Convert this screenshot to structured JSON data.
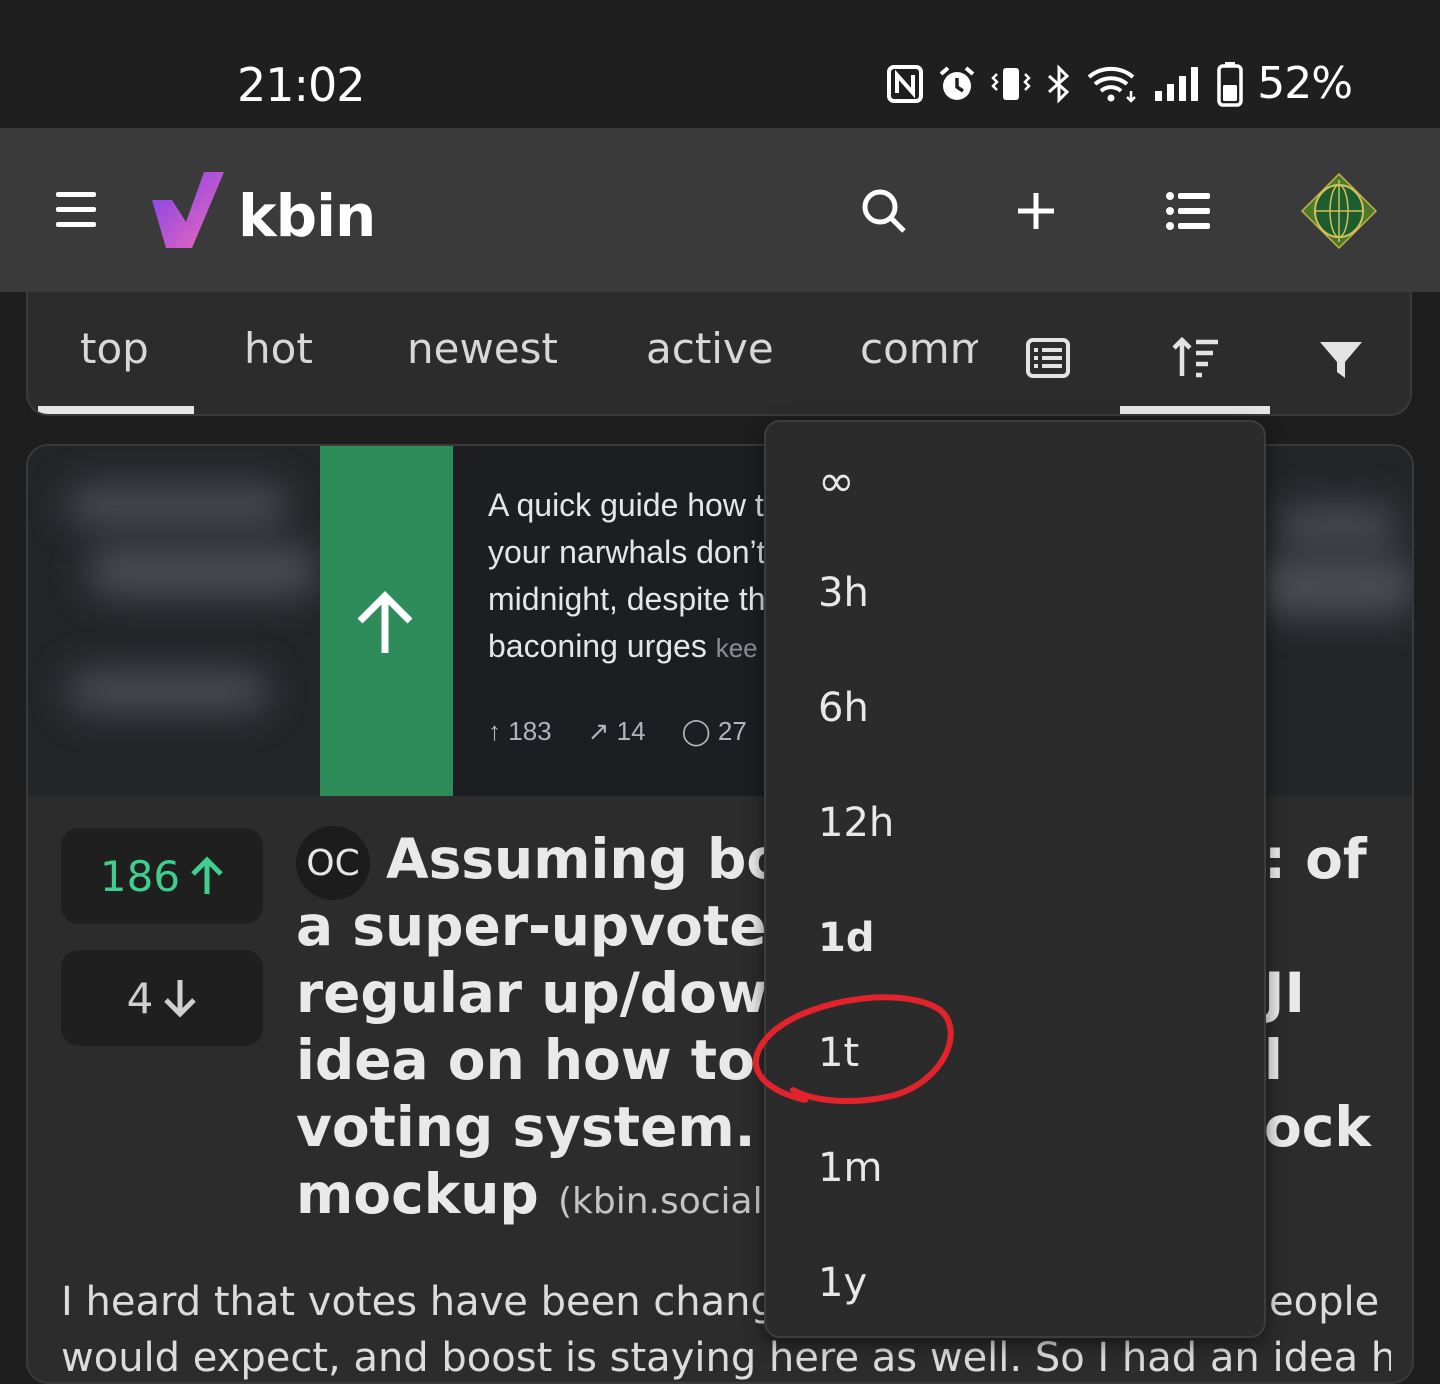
{
  "status_bar": {
    "time": "21:02",
    "battery_percent": "52%"
  },
  "app_bar": {
    "brand": "kbin"
  },
  "tabs": [
    "top",
    "hot",
    "newest",
    "active",
    "comm"
  ],
  "active_tab": "top",
  "embed": {
    "text_lines": [
      "A quick guide how t",
      "your narwhals don’t",
      "midnight, despite th",
      "baconing urges"
    ],
    "source_tag": "kee",
    "upvotes": "183",
    "boosts": "14",
    "comments": "27"
  },
  "post": {
    "upvotes": "186",
    "downvotes": "4",
    "oc_badge": "OC",
    "title_lines": [
      "Assuming boos",
      "a super-upvote/sha",
      "regular up/downvo",
      "idea on how to me",
      "voting system. App",
      "mockup"
    ],
    "title_right_fragments": [
      ": of",
      "JI",
      "l",
      "ock"
    ],
    "domain": "(kbin.social)",
    "body_line1_left": "I heard that votes have been changed",
    "body_line1_right": "eople",
    "body_line2": "would expect, and boost is staying here as well. So I had an idea how"
  },
  "time_filter_menu": {
    "items": [
      "∞",
      "3h",
      "6h",
      "12h",
      "1d",
      "1t",
      "1m",
      "1y"
    ],
    "selected": "1d",
    "annotated": "1t"
  },
  "colors": {
    "upvote_green": "#3ecf8e",
    "embed_green": "#2e8b5a",
    "annotation_red": "#e3232c",
    "logo_gradient": [
      "#7b3ff2",
      "#f06bb5"
    ]
  }
}
